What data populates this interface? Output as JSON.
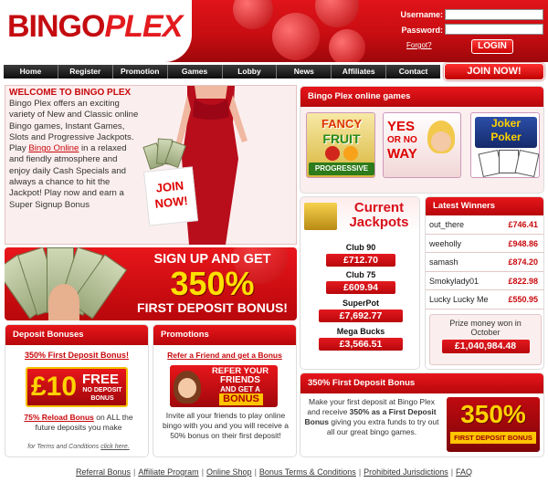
{
  "header": {
    "logo_bingo": "BINGO",
    "logo_plex": "PLEX",
    "username_label": "Username:",
    "password_label": "Password:",
    "forgot_label": "Forgot?",
    "login_label": "LOGIN"
  },
  "nav": {
    "items": [
      "Home",
      "Register",
      "Promotion",
      "Games",
      "Lobby",
      "News",
      "Affiliates",
      "Contact"
    ],
    "join_label": "JOIN NOW!"
  },
  "welcome": {
    "title": "WELCOME TO BINGO PLEX",
    "text_before_link": "Bingo Plex offers an exciting variety of New and Classic online Bingo games, Instant Games, Slots and Progressive Jackpots. Play ",
    "link": "Bingo Online",
    "text_after_link": " in a relaxed and fiendly atmosphere and enjoy daily Cash Specials and always a chance to hit the Jackpot! Play now and earn a Super Signup Bonus",
    "sign_line1": "JOIN",
    "sign_line2": "NOW!"
  },
  "signup_banner": {
    "line1": "SIGN UP AND GET",
    "line2": "350%",
    "line3": "FIRST DEPOSIT BONUS!"
  },
  "online_games": {
    "title": "Bingo Plex online games",
    "games": [
      {
        "line1": "FANCY",
        "line2": "FRUIT",
        "line3": "PROGRESSIVE"
      },
      {
        "line1": "YES",
        "line2": "OR NO",
        "line3": "WAY"
      },
      {
        "line1": "Joker",
        "line2": "Poker",
        "line3": ""
      }
    ]
  },
  "jackpots": {
    "title_line1": "Current",
    "title_line2": "Jackpots",
    "items": [
      {
        "name": "Club 90",
        "value": "£712.70"
      },
      {
        "name": "Club 75",
        "value": "£609.94"
      },
      {
        "name": "SuperPot",
        "value": "£7,692.77"
      },
      {
        "name": "Mega Bucks",
        "value": "£3,566.51"
      }
    ]
  },
  "winners": {
    "title": "Latest Winners",
    "rows": [
      {
        "name": "out_there",
        "amount": "£746.41"
      },
      {
        "name": "weeholly",
        "amount": "£948.86"
      },
      {
        "name": "samash",
        "amount": "£874.20"
      },
      {
        "name": "Smokylady01",
        "amount": "£822.98"
      },
      {
        "name": "Lucky Lucky Me",
        "amount": "£550.95"
      }
    ],
    "prize_label_line1": "Prize money won in",
    "prize_label_line2": "October",
    "prize_value": "£1,040,984.48"
  },
  "deposit_bonuses": {
    "title": "Deposit Bonuses",
    "link": "350% First Deposit Bonus!",
    "badge_amount": "£10",
    "badge_free": "FREE",
    "badge_sub1": "NO DEPOSIT",
    "badge_sub2": "BONUS",
    "reload_link": "75% Reload Bonus",
    "reload_text": " on ALL the future deposits you make",
    "terms_prefix": "for Terms and Conditions ",
    "terms_link": "click here."
  },
  "promotions": {
    "title": "Promotions",
    "link": "Refer a Friend and get a Bonus",
    "banner_line1": "REFER YOUR",
    "banner_line2": "FRIENDS",
    "banner_line3": "AND GET A",
    "banner_line4": "BONUS",
    "text": "Invite all your friends to play online bingo with you and you will receive a 50% bonus on their first deposit!"
  },
  "first_deposit": {
    "title": "350% First Deposit Bonus",
    "text_before": "Make your first deposit at Bingo Plex and receive ",
    "bold1": "350% as a First Deposit Bonus",
    "text_after": " giving you extra funds to try out all our great bingo games.",
    "badge_pct": "350%",
    "badge_sub": "FIRST DEPOSIT BONUS"
  },
  "footer": {
    "links": [
      "Referral Bonus",
      "Affiliate Program",
      "Online Shop",
      "Bonus Terms & Conditions",
      "Prohibited Jurisdictions",
      "FAQ"
    ],
    "separator": "|"
  },
  "colors": {
    "brand_red": "#d8101a",
    "dark_red": "#a0070b",
    "accent_yellow": "#ffe000",
    "nav_black": "#111111"
  }
}
